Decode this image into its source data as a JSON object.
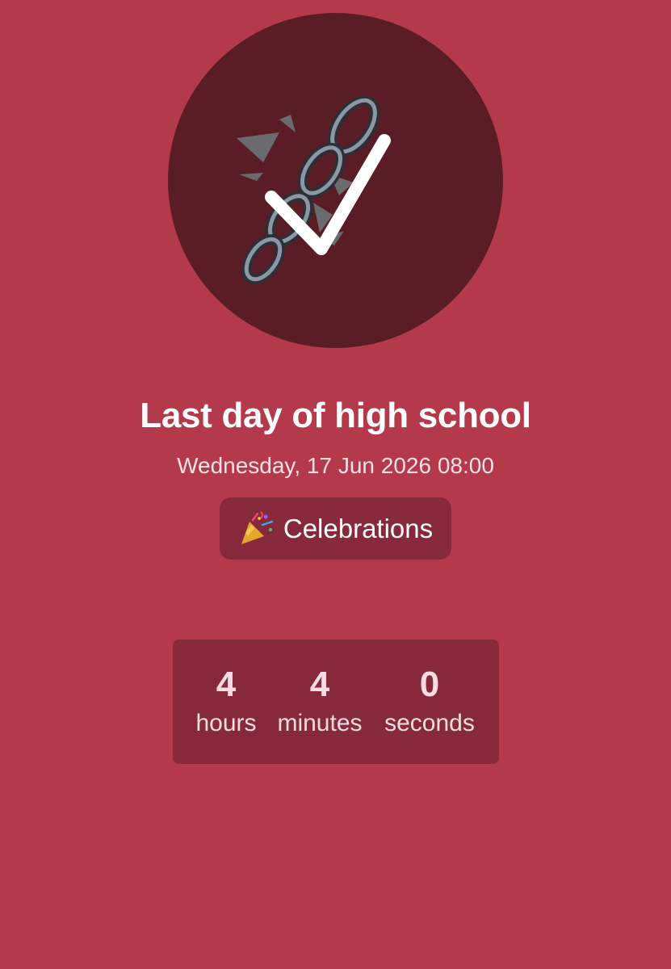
{
  "event": {
    "title": "Last day of high school",
    "date": "Wednesday, 17 Jun 2026 08:00",
    "icon": "broken-chain-checkmark-icon"
  },
  "category": {
    "icon": "party-popper-icon",
    "label": "Celebrations"
  },
  "countdown": {
    "hours": {
      "value": "4",
      "label": "hours"
    },
    "minutes": {
      "value": "4",
      "label": "minutes"
    },
    "seconds": {
      "value": "0",
      "label": "seconds"
    }
  },
  "colors": {
    "background": "#B3394B",
    "hero_circle": "#5A1D25",
    "panel": "#86293A",
    "text": "#FFFFFF"
  }
}
